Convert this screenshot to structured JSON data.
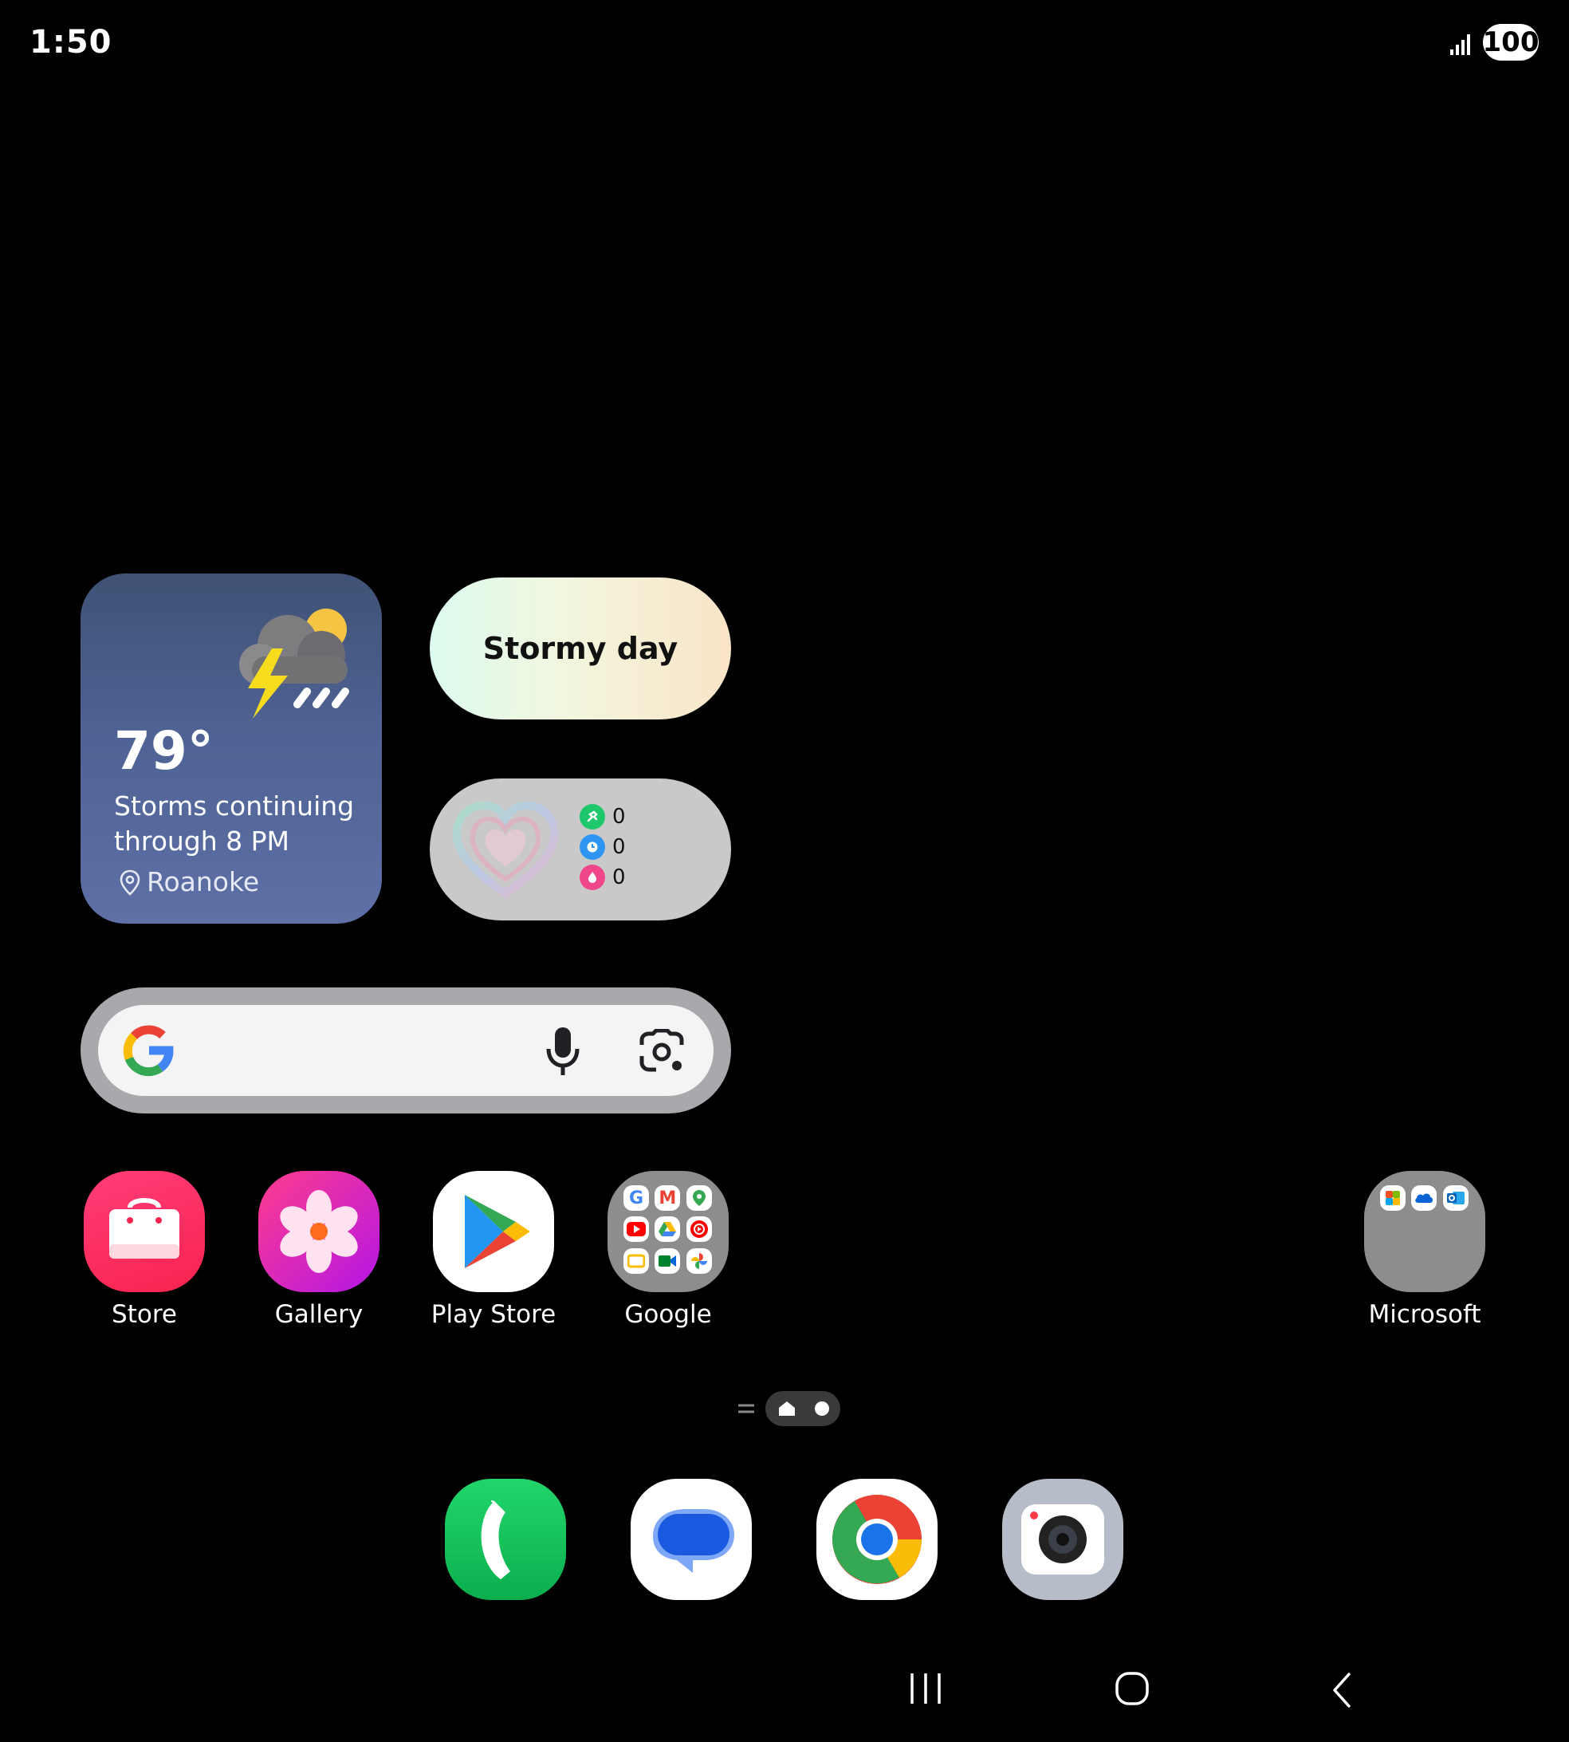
{
  "status_bar": {
    "time": "1:50",
    "battery": "100"
  },
  "weather": {
    "temperature": "79°",
    "description": "Storms continuing through 8 PM",
    "location": "Roanoke"
  },
  "mood_widget": {
    "text": "Stormy day"
  },
  "health_widget": {
    "stats": [
      {
        "icon": "steps-icon",
        "value": "0",
        "color": "#1ec76b"
      },
      {
        "icon": "active-time-icon",
        "value": "0",
        "color": "#2f95f2"
      },
      {
        "icon": "calories-icon",
        "value": "0",
        "color": "#f0468a"
      }
    ]
  },
  "search_bar": {
    "icons": [
      "google-logo",
      "mic-icon",
      "lens-icon"
    ]
  },
  "apps": [
    {
      "label": "Store"
    },
    {
      "label": "Gallery"
    },
    {
      "label": "Play Store"
    },
    {
      "label": "Google"
    },
    {
      "label": "Microsoft"
    }
  ],
  "dock": [
    "phone",
    "messages",
    "chrome",
    "camera"
  ],
  "nav": [
    "recents-button",
    "home-button",
    "back-button"
  ]
}
